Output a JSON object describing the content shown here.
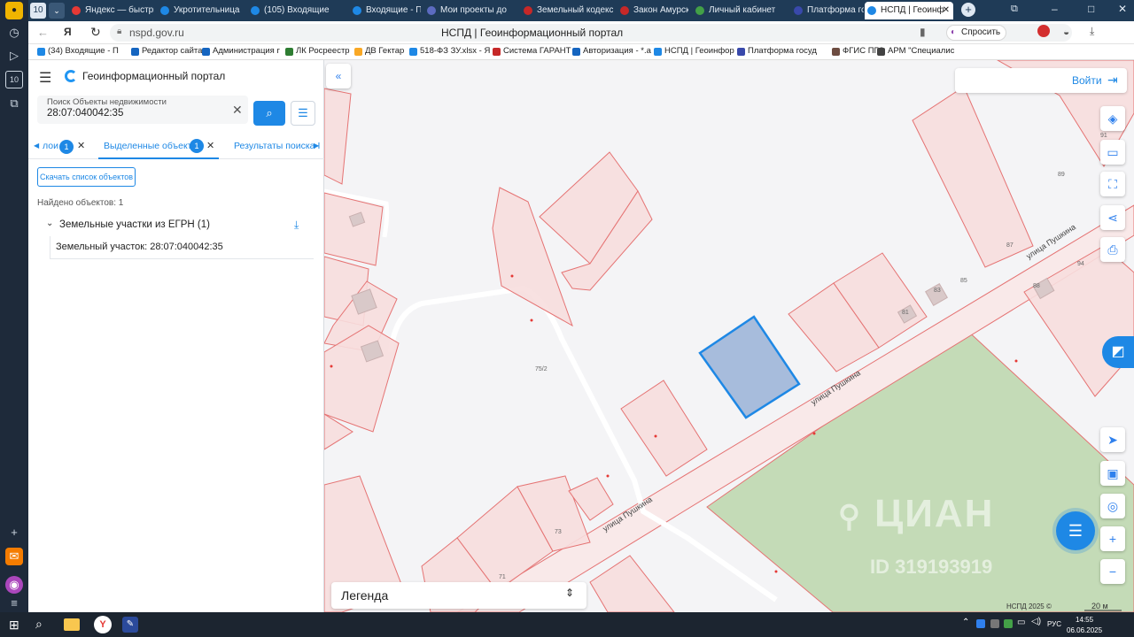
{
  "browser": {
    "tab_counter": "10",
    "tabs": [
      {
        "label": "Яндекс — быстрый",
        "color": "#e53935"
      },
      {
        "label": "Укротительница",
        "color": "#1e88e5"
      },
      {
        "label": "(105) Входящие",
        "color": "#1e88e5"
      },
      {
        "label": "Входящие - Почта",
        "color": "#1e88e5"
      },
      {
        "label": "Мои проекты до",
        "color": "#5c6bc0"
      },
      {
        "label": "Земельный кодекс",
        "color": "#c62828"
      },
      {
        "label": "Закон Амурской",
        "color": "#c62828"
      },
      {
        "label": "Личный кабинет",
        "color": "#43a047"
      },
      {
        "label": "Платформа госуд",
        "color": "#3949ab"
      },
      {
        "label": "НСПД | Геоинф",
        "color": "#1e88e5"
      }
    ],
    "url": "nspd.gov.ru",
    "page_title": "НСПД | Геоинформационный портал",
    "ask_label": "Спросить",
    "bookmarks": [
      {
        "label": "(34) Входящие - П",
        "color": "#1e88e5"
      },
      {
        "label": "Редактор сайта а",
        "color": "#1565c0"
      },
      {
        "label": "Администрация г",
        "color": "#1565c0"
      },
      {
        "label": "ЛК Росреестр",
        "color": "#2e7d32"
      },
      {
        "label": "ДВ Гектар",
        "color": "#f9a825"
      },
      {
        "label": "518-ФЗ ЗУ.xlsx - Я",
        "color": "#1e88e5"
      },
      {
        "label": "Система ГАРАНТ",
        "color": "#c62828"
      },
      {
        "label": "Авторизация - *.a",
        "color": "#1565c0"
      },
      {
        "label": "НСПД | Геоинфор",
        "color": "#1e88e5"
      },
      {
        "label": "Платформа госуд",
        "color": "#3949ab"
      },
      {
        "label": "ФГИС ПГС",
        "color": "#6d4c41"
      },
      {
        "label": "АРМ \"Специалис",
        "color": "#424242"
      }
    ]
  },
  "portal": {
    "title": "Геоинформационный портал",
    "search_label": "Поиск Объекты недвижимости",
    "search_value": "28:07:040042:35",
    "tabs": [
      {
        "label": "лои",
        "count": "1"
      },
      {
        "label": "Выделенные объекты",
        "count": "1"
      },
      {
        "label": "Результаты поиска I"
      }
    ],
    "download_list_label": "Скачать список объектов",
    "found_label": "Найдено объектов: 1",
    "group_label": "Земельные участки из ЕГРН (1)",
    "result_item": "Земельный участок: 28:07:040042:35"
  },
  "map": {
    "login_label": "Войти",
    "legend_label": "Легенда",
    "street_labels": [
      "улица Пушкина",
      "улица Пушкина",
      "улица Пушкина"
    ],
    "house_numbers": [
      "91",
      "89",
      "87",
      "94",
      "85",
      "83",
      "88",
      "81",
      "75/2",
      "73",
      "71"
    ],
    "watermark": "ЦИАН",
    "watermark_id": "ID 319193919",
    "copyright": "НСПД 2025 ©",
    "scale": "20 м",
    "colors": {
      "parcel_fill": "#f7dede",
      "parcel_stroke": "#e57373",
      "selected_fill": "#9fb6d9",
      "selected_stroke": "#1e88e5",
      "green_zone": "#b8d4a8"
    }
  },
  "taskbar": {
    "language": "РУС",
    "time": "14:55",
    "date": "06.06.2025"
  }
}
